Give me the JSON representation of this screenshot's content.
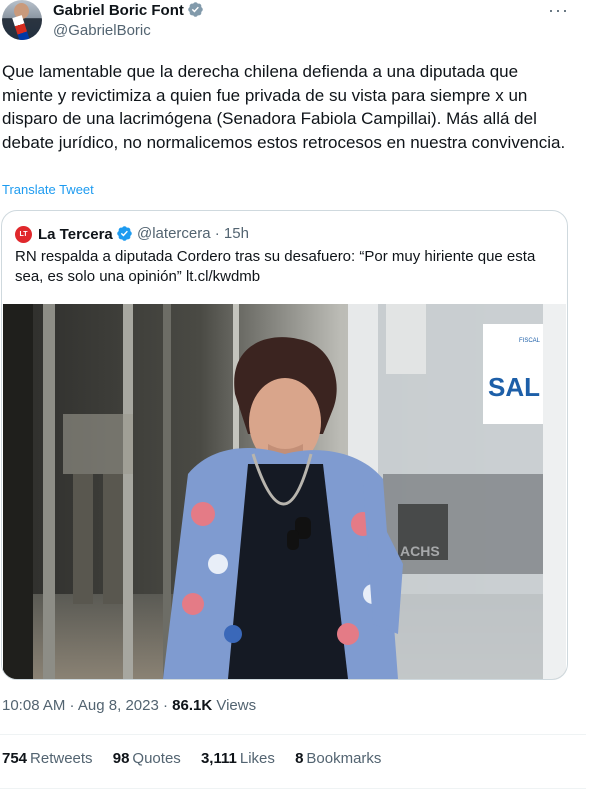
{
  "author": {
    "name": "Gabriel Boric Font",
    "handle": "@GabrielBoric"
  },
  "tweet": {
    "text": "Que lamentable que la derecha chilena defienda a una diputada que miente y revictimiza a quien fue privada de su vista para siempre x un disparo de una lacrimógena (Senadora Fabiola Campillai). Más allá del debate jurídico, no normalicemos estos retrocesos en nuestra convivencia.",
    "translate_label": "Translate Tweet",
    "more_label": "···"
  },
  "quoted": {
    "logo_text": "LT",
    "name": "La Tercera",
    "handle_time": "@latercera · 15h",
    "text": "RN respalda a diputada Cordero tras su desafuero: “Por muy hiriente que esta sea, es solo una opinión” lt.cl/kwdmb",
    "image": {
      "sign_text": "SAL",
      "achs_text": "ACHS",
      "fiscal_text": "FISCAL"
    }
  },
  "meta": {
    "time": "10:08 AM",
    "sep1": " · ",
    "date": "Aug 8, 2023",
    "sep2": " · ",
    "views_count": "86.1K",
    "views_label": "Views"
  },
  "stats": {
    "retweets_count": "754",
    "retweets_label": "Retweets",
    "quotes_count": "98",
    "quotes_label": "Quotes",
    "likes_count": "3,111",
    "likes_label": "Likes",
    "bookmarks_count": "8",
    "bookmarks_label": "Bookmarks"
  },
  "colors": {
    "accent": "#1d9bf0",
    "text": "#0f1419",
    "secondary": "#536471",
    "border": "#cfd9de"
  }
}
